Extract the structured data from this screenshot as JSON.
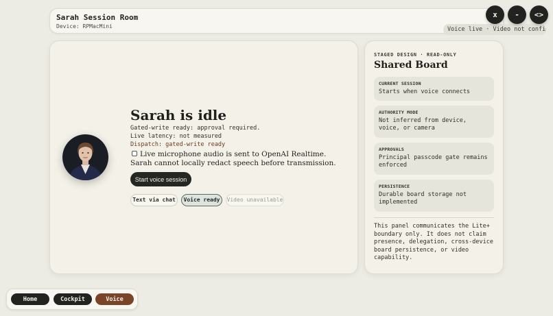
{
  "header": {
    "title": "Sarah Session Room",
    "device": "Device: RPMacMini",
    "status_pill": "Voice live · Video not configured"
  },
  "window_controls": {
    "close": "x",
    "minimize": "-",
    "expand": "<>"
  },
  "main": {
    "avatar_icon": "person-portrait",
    "status_title": "Sarah is idle",
    "lines": {
      "gated": "Gated-write ready: approval required.",
      "latency": "Live latency: not measured",
      "dispatch": "Dispatch: gated-write ready"
    },
    "consent_text": "Live microphone audio is sent to OpenAI Realtime. Sarah cannot locally redact speech before transmission.",
    "start_button": "Start voice session",
    "chips": {
      "text_chat": "Text via chat",
      "voice_ready": "Voice ready",
      "video_unavailable": "Video unavailable"
    }
  },
  "side_panel": {
    "eyebrow": "STAGED DESIGN · READ-ONLY",
    "heading": "Shared Board",
    "sections": [
      {
        "label": "CURRENT SESSION",
        "value": "Starts when voice connects"
      },
      {
        "label": "AUTHORITY MODE",
        "value": "Not inferred from device, voice, or camera"
      },
      {
        "label": "APPROVALS",
        "value": "Principal passcode gate remains enforced"
      },
      {
        "label": "PERSISTENCE",
        "value": "Durable board storage not implemented"
      }
    ],
    "note": "This panel communicates the Lite+ boundary only. It does not claim presence, delegation, cross-device board persistence, or video capability."
  },
  "bottom_nav": {
    "home": "Home",
    "cockpit": "Cockpit",
    "voice": "Voice"
  },
  "colors": {
    "background": "#ecebe4",
    "dark_button": "#222320",
    "accent_voice": "#7a4428",
    "dispatch_text": "#6a3a1f"
  }
}
